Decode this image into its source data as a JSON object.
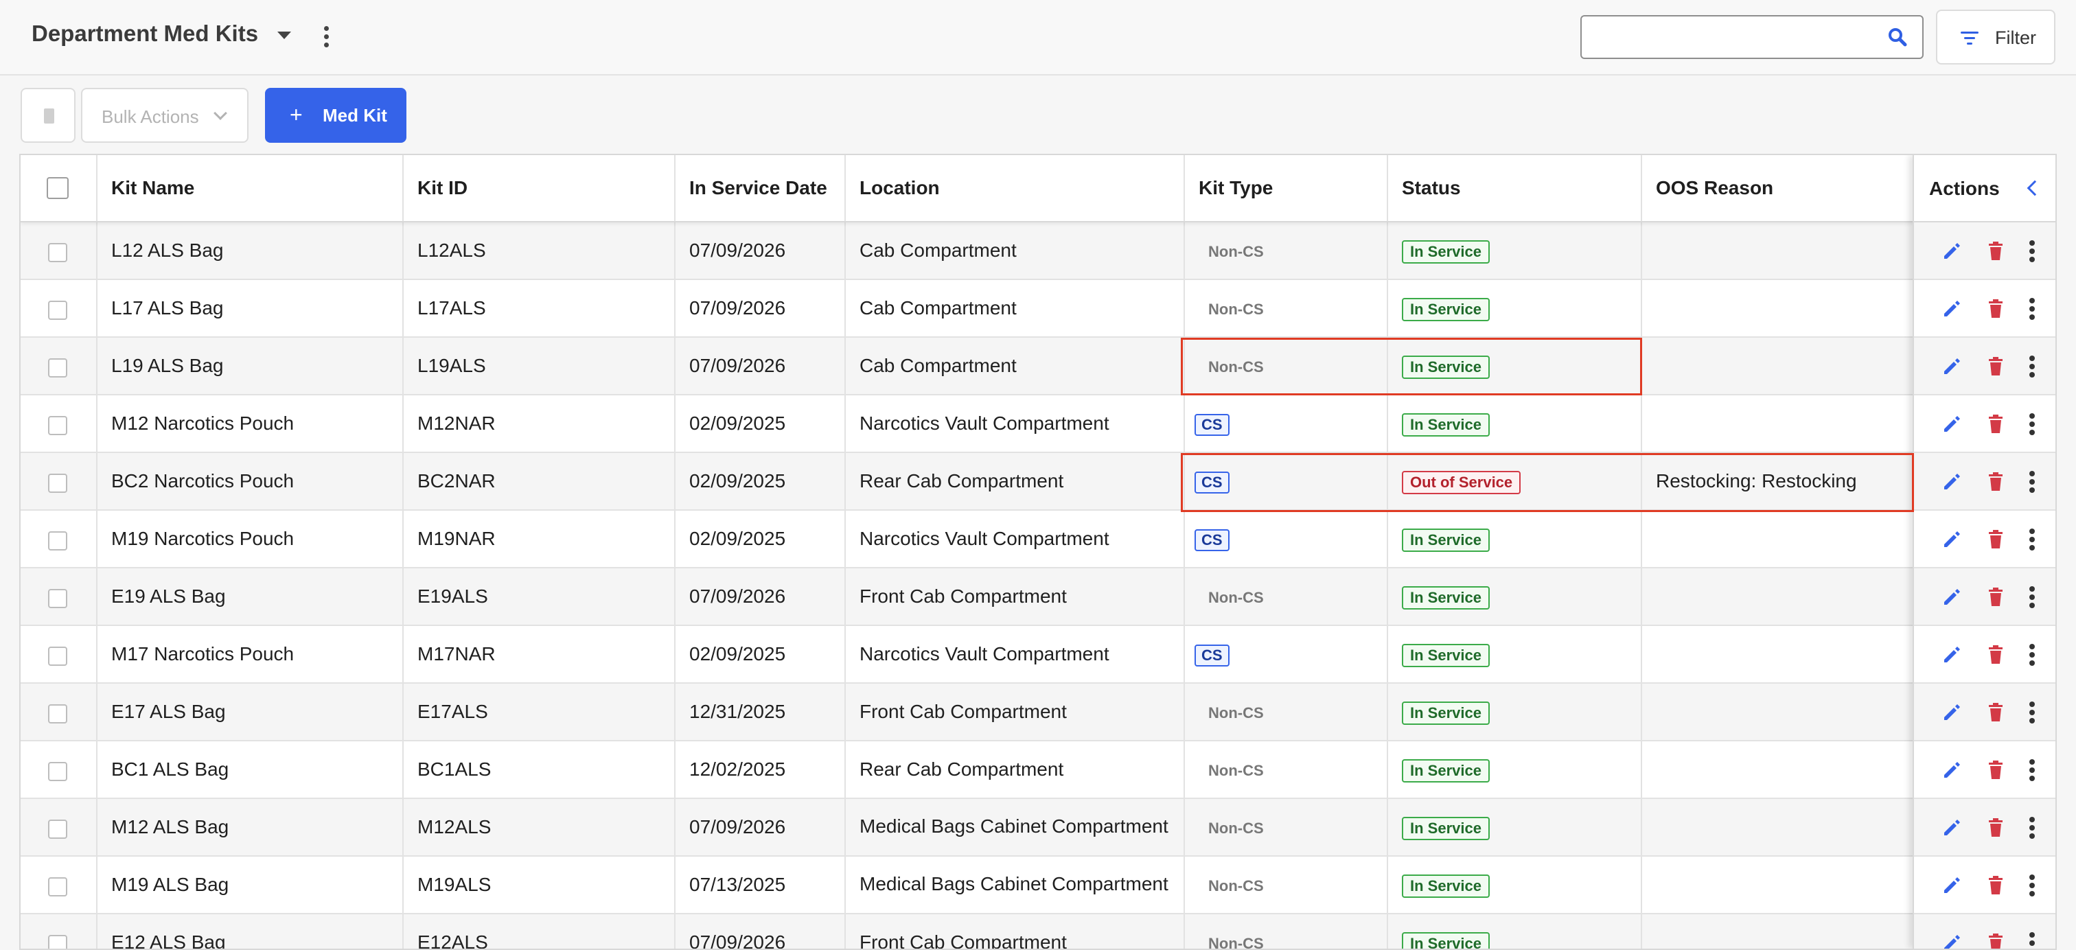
{
  "header": {
    "title": "Department Med Kits",
    "search_placeholder": "",
    "filter_label": "Filter"
  },
  "toolbar": {
    "bulk_actions_label": "Bulk Actions",
    "add_label": "Med Kit",
    "add_plus": "+"
  },
  "table": {
    "columns": [
      "Kit Name",
      "Kit ID",
      "In Service Date",
      "Location",
      "Kit Type",
      "Status",
      "OOS Reason"
    ],
    "actions_label": "Actions",
    "rows": [
      {
        "name": "L12 ALS Bag",
        "id": "L12ALS",
        "date": "07/09/2026",
        "location": "Cab Compartment",
        "type": "Non-CS",
        "status": "In Service",
        "oos": ""
      },
      {
        "name": "L17 ALS Bag",
        "id": "L17ALS",
        "date": "07/09/2026",
        "location": "Cab Compartment",
        "type": "Non-CS",
        "status": "In Service",
        "oos": ""
      },
      {
        "name": "L19 ALS Bag",
        "id": "L19ALS",
        "date": "07/09/2026",
        "location": "Cab Compartment",
        "type": "Non-CS",
        "status": "In Service",
        "oos": ""
      },
      {
        "name": "M12 Narcotics Pouch",
        "id": "M12NAR",
        "date": "02/09/2025",
        "location": "Narcotics Vault Compartment",
        "type": "CS",
        "status": "In Service",
        "oos": ""
      },
      {
        "name": "BC2 Narcotics Pouch",
        "id": "BC2NAR",
        "date": "02/09/2025",
        "location": "Rear Cab Compartment",
        "type": "CS",
        "status": "Out of Service",
        "oos": "Restocking: Restocking"
      },
      {
        "name": "M19 Narcotics Pouch",
        "id": "M19NAR",
        "date": "02/09/2025",
        "location": "Narcotics Vault Compartment",
        "type": "CS",
        "status": "In Service",
        "oos": ""
      },
      {
        "name": "E19 ALS Bag",
        "id": "E19ALS",
        "date": "07/09/2026",
        "location": "Front Cab Compartment",
        "type": "Non-CS",
        "status": "In Service",
        "oos": ""
      },
      {
        "name": "M17 Narcotics Pouch",
        "id": "M17NAR",
        "date": "02/09/2025",
        "location": "Narcotics Vault Compartment",
        "type": "CS",
        "status": "In Service",
        "oos": ""
      },
      {
        "name": "E17 ALS Bag",
        "id": "E17ALS",
        "date": "12/31/2025",
        "location": "Front Cab Compartment",
        "type": "Non-CS",
        "status": "In Service",
        "oos": ""
      },
      {
        "name": "BC1 ALS Bag",
        "id": "BC1ALS",
        "date": "12/02/2025",
        "location": "Rear Cab Compartment",
        "type": "Non-CS",
        "status": "In Service",
        "oos": ""
      },
      {
        "name": "M12 ALS Bag",
        "id": "M12ALS",
        "date": "07/09/2026",
        "location": "Medical Bags Cabinet Compartment",
        "type": "Non-CS",
        "status": "In Service",
        "oos": ""
      },
      {
        "name": "M19 ALS Bag",
        "id": "M19ALS",
        "date": "07/13/2025",
        "location": "Medical Bags Cabinet Compartment",
        "type": "Non-CS",
        "status": "In Service",
        "oos": ""
      },
      {
        "name": "E12 ALS Bag",
        "id": "E12ALS",
        "date": "07/09/2026",
        "location": "Front Cab Compartment",
        "type": "Non-CS",
        "status": "In Service",
        "oos": ""
      }
    ]
  },
  "colors": {
    "accent": "#3563e9",
    "in_service": "#3bab49",
    "out_of_service": "#d33a46",
    "highlight": "#e03b24"
  }
}
